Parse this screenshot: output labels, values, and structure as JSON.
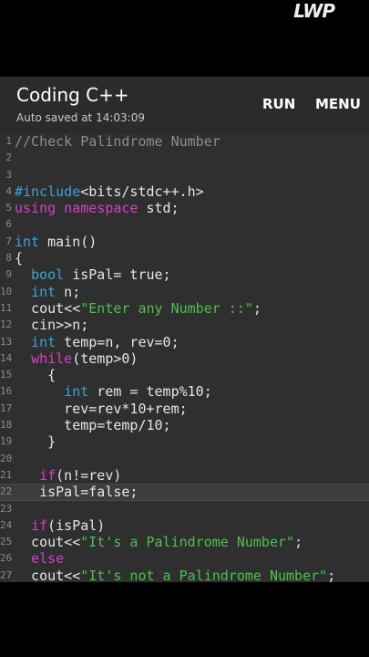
{
  "watermark": "LWP",
  "appbar": {
    "title": "Coding C++",
    "subtitle": "Auto saved at 14:03:09",
    "run_label": "RUN",
    "menu_label": "MENU"
  },
  "colors": {
    "background": "#000000",
    "appbar": "#2b2b2b",
    "editor": "#2f2f2f",
    "keyword": "#d63fc9",
    "type": "#3ea1d8",
    "string": "#4cc04c",
    "comment": "#8e8e8e",
    "text": "#e6e6e6"
  },
  "editor": {
    "current_line": 22,
    "lines": [
      {
        "n": "1",
        "tokens": [
          {
            "t": "//Check Palindrome Number",
            "c": "c"
          }
        ]
      },
      {
        "n": "2",
        "tokens": []
      },
      {
        "n": "3",
        "tokens": []
      },
      {
        "n": "4",
        "tokens": [
          {
            "t": "#include",
            "c": "t"
          },
          {
            "t": "<bits/stdc++.h>",
            "c": "p"
          }
        ]
      },
      {
        "n": "5",
        "tokens": [
          {
            "t": "using",
            "c": "k"
          },
          {
            "t": " ",
            "c": "p"
          },
          {
            "t": "namespace",
            "c": "k"
          },
          {
            "t": " std;",
            "c": "p"
          }
        ]
      },
      {
        "n": "6",
        "tokens": []
      },
      {
        "n": "7",
        "tokens": [
          {
            "t": "int",
            "c": "t"
          },
          {
            "t": " main()",
            "c": "p"
          }
        ]
      },
      {
        "n": "8",
        "tokens": [
          {
            "t": "{",
            "c": "p"
          }
        ]
      },
      {
        "n": "9",
        "tokens": [
          {
            "t": "  ",
            "c": "p"
          },
          {
            "t": "bool",
            "c": "t"
          },
          {
            "t": " isPal= true;",
            "c": "p"
          }
        ]
      },
      {
        "n": "10",
        "tokens": [
          {
            "t": "  ",
            "c": "p"
          },
          {
            "t": "int",
            "c": "t"
          },
          {
            "t": " n;",
            "c": "p"
          }
        ]
      },
      {
        "n": "11",
        "tokens": [
          {
            "t": "  cout<<",
            "c": "p"
          },
          {
            "t": "\"Enter any Number ::\"",
            "c": "s"
          },
          {
            "t": ";",
            "c": "p"
          }
        ]
      },
      {
        "n": "12",
        "tokens": [
          {
            "t": "  cin>>n;",
            "c": "p"
          }
        ]
      },
      {
        "n": "13",
        "tokens": [
          {
            "t": "  ",
            "c": "p"
          },
          {
            "t": "int",
            "c": "t"
          },
          {
            "t": " temp=n, rev=0;",
            "c": "p"
          }
        ]
      },
      {
        "n": "14",
        "tokens": [
          {
            "t": "  ",
            "c": "p"
          },
          {
            "t": "while",
            "c": "k"
          },
          {
            "t": "(temp>0)",
            "c": "p"
          }
        ]
      },
      {
        "n": "15",
        "tokens": [
          {
            "t": "    {",
            "c": "p"
          }
        ]
      },
      {
        "n": "16",
        "tokens": [
          {
            "t": "      ",
            "c": "p"
          },
          {
            "t": "int",
            "c": "t"
          },
          {
            "t": " rem = temp%10;",
            "c": "p"
          }
        ]
      },
      {
        "n": "17",
        "tokens": [
          {
            "t": "      rev=rev*10+rem;",
            "c": "p"
          }
        ]
      },
      {
        "n": "18",
        "tokens": [
          {
            "t": "      temp=temp/10;",
            "c": "p"
          }
        ]
      },
      {
        "n": "19",
        "tokens": [
          {
            "t": "    }",
            "c": "p"
          }
        ]
      },
      {
        "n": "20",
        "tokens": []
      },
      {
        "n": "21",
        "tokens": [
          {
            "t": "   ",
            "c": "p"
          },
          {
            "t": "if",
            "c": "k"
          },
          {
            "t": "(n!=rev)",
            "c": "p"
          }
        ]
      },
      {
        "n": "22",
        "tokens": [
          {
            "t": "   isPal=false;",
            "c": "p"
          }
        ]
      },
      {
        "n": "23",
        "tokens": []
      },
      {
        "n": "24",
        "tokens": [
          {
            "t": "  ",
            "c": "p"
          },
          {
            "t": "if",
            "c": "k"
          },
          {
            "t": "(isPal)",
            "c": "p"
          }
        ]
      },
      {
        "n": "25",
        "tokens": [
          {
            "t": "  cout<<",
            "c": "p"
          },
          {
            "t": "\"It's a Palindrome Number\"",
            "c": "s"
          },
          {
            "t": ";",
            "c": "p"
          }
        ]
      },
      {
        "n": "26",
        "tokens": [
          {
            "t": "  ",
            "c": "p"
          },
          {
            "t": "else",
            "c": "k"
          }
        ]
      },
      {
        "n": "27",
        "tokens": [
          {
            "t": "  cout<<",
            "c": "p"
          },
          {
            "t": "\"It's not a Palindrome Number\"",
            "c": "s"
          },
          {
            "t": ";",
            "c": "p"
          }
        ]
      }
    ]
  }
}
